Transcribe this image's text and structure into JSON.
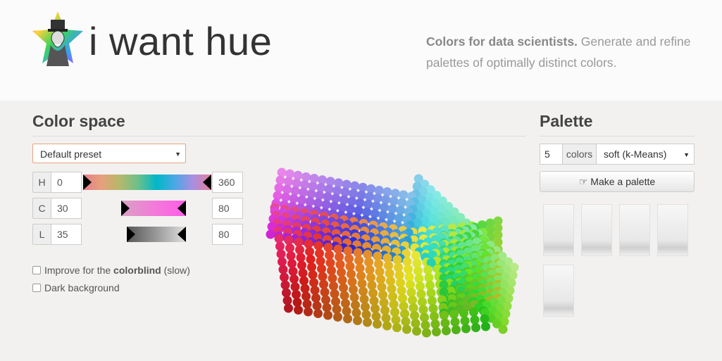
{
  "header": {
    "app_title": "i want hue",
    "tagline_bold": "Colors for data scientists.",
    "tagline_rest": " Generate and refine palettes of optimally distinct colors."
  },
  "color_space": {
    "title": "Color space",
    "preset": "Default preset",
    "hue": {
      "label": "H",
      "min": "0",
      "max": "360"
    },
    "chroma": {
      "label": "C",
      "min": "30",
      "max": "80"
    },
    "lightness": {
      "label": "L",
      "min": "35",
      "max": "80"
    },
    "colorblind_prefix": "Improve for the ",
    "colorblind_bold": "colorblind",
    "colorblind_suffix": " (slow)",
    "dark_background": "Dark background",
    "colorblind_checked": false,
    "dark_checked": false
  },
  "palette": {
    "title": "Palette",
    "count": "5",
    "count_label": "colors",
    "mode": "soft (k-Means)",
    "make_label": "Make a palette",
    "make_icon": "pointing-hand-icon",
    "swatch_count": 5
  },
  "colors": {
    "accent_border": "#e8a37e",
    "background": "#f2f1f0"
  }
}
